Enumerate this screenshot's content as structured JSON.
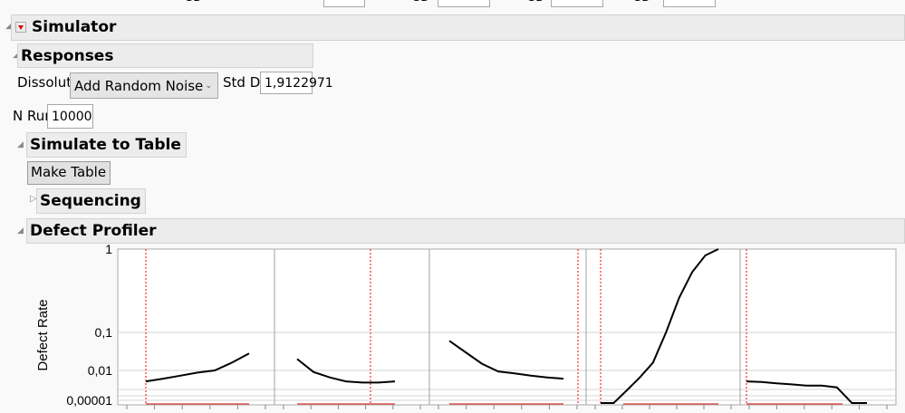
{
  "top_row": {
    "sd_label": "SD"
  },
  "simulator": {
    "title": "Simulator",
    "responses": {
      "title": "Responses",
      "response_name": "Dissolution",
      "method_value": "Add Random Noise",
      "std_dev_label": "Std Dev:",
      "std_dev_value": "1,9122971"
    },
    "n_runs_label": "N Runs:",
    "n_runs_value": "10000",
    "simulate_to_table": {
      "title": "Simulate to Table",
      "make_table_label": "Make Table"
    },
    "sequencing": {
      "title": "Sequencing"
    },
    "defect_profiler": {
      "title": "Defect Profiler"
    }
  },
  "chart_data": {
    "type": "line",
    "ylabel": "Defect Rate",
    "yticks": [
      "1",
      "0,1",
      "0,01",
      "0,00001"
    ],
    "ytick_values": [
      1,
      0.1,
      0.01,
      1e-05
    ],
    "grid": true,
    "colors": {
      "curve": "#000000",
      "reference": "#ff0000",
      "spec": "#d9534f"
    },
    "panels": [
      {
        "curve": [
          0.0008,
          0.0015,
          0.003,
          0.006,
          0.01,
          0.016,
          0.028
        ]
      },
      {
        "curve": [
          0.02,
          0.007,
          0.002,
          0.0008,
          0.0006,
          0.0006,
          0.0008
        ]
      },
      {
        "curve": [
          0.06,
          0.03,
          0.015,
          0.008,
          0.005,
          0.003,
          0.002,
          0.0015
        ]
      },
      {
        "curve": [
          5e-06,
          5e-06,
          0.0001,
          0.002,
          0.016,
          0.1,
          0.26,
          0.53,
          0.84,
          1.0
        ]
      },
      {
        "curve": [
          0.0008,
          0.0007,
          0.0005,
          0.0004,
          0.0003,
          0.0003,
          0.0002,
          5e-06,
          5e-06
        ]
      }
    ]
  }
}
